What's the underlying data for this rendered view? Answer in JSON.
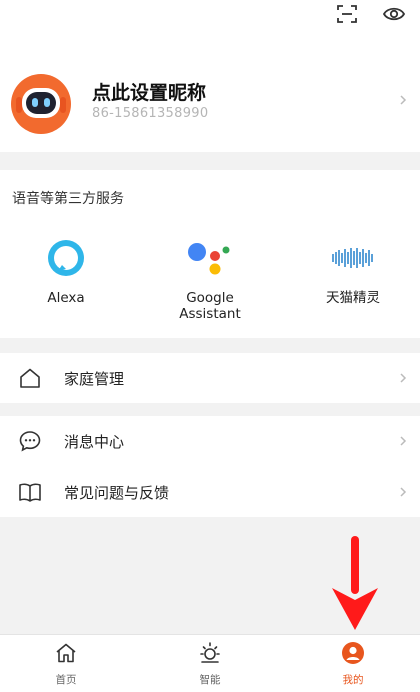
{
  "header": {
    "nickname": "点此设置昵称",
    "account": "86-15861358990",
    "scan_icon": "scan-icon",
    "eye_icon": "eye-icon"
  },
  "services": {
    "title": "语音等第三方服务",
    "items": [
      {
        "name": "Alexa",
        "icon": "alexa-icon"
      },
      {
        "name": "Google\nAssistant",
        "icon": "google-assistant-icon"
      },
      {
        "name": "天猫精灵",
        "icon": "tmall-genie-icon"
      }
    ]
  },
  "menu": {
    "home_management": "家庭管理",
    "message_center": "消息中心",
    "faq_feedback": "常见问题与反馈"
  },
  "bottom_nav": {
    "tabs": [
      {
        "label": "首页",
        "icon": "home-icon"
      },
      {
        "label": "智能",
        "icon": "sun-icon"
      },
      {
        "label": "我的",
        "icon": "profile-icon",
        "active": true
      }
    ]
  },
  "colors": {
    "accent": "#e8561e",
    "annotation_arrow": "#ff1a1a"
  }
}
